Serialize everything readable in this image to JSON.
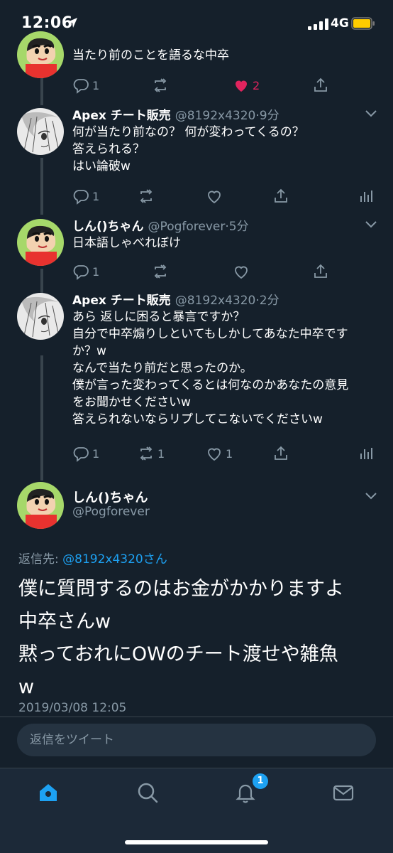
{
  "status_bar": {
    "time": "12:06",
    "network": "4G"
  },
  "tweets": [
    {
      "body": "当たり前のことを語るな中卒",
      "reply_count": "1",
      "like_count": "2"
    },
    {
      "name": "Apex チート販売",
      "handle": "@8192x4320",
      "time": "9分",
      "lines": [
        "何が当たり前なの？ 何が変わってくるの？",
        "答えられる？",
        "はい論破w"
      ],
      "reply_count": "1"
    },
    {
      "name": "しん()ちゃん",
      "handle": "@Pogforever",
      "time": "5分",
      "lines": [
        "日本語しゃべれぼけ"
      ],
      "reply_count": "1"
    },
    {
      "name": "Apex チート販売",
      "handle": "@8192x4320",
      "time": "2分",
      "lines": [
        "あら 返しに困ると暴言ですか？",
        "自分で中卒煽りしといてもしかしてあなた中卒です",
        "か？w",
        "なんで当たり前だと思ったのか。",
        "僕が言った変わってくるとは何なのかあなたの意見",
        "をお聞かせくださいw",
        "答えられないならリプしてこないでくださいw"
      ],
      "reply_count": "1",
      "retweet_count": "1",
      "like_count": "1"
    }
  ],
  "main_tweet": {
    "name": "しん()ちゃん",
    "handle": "@Pogforever",
    "reply_prefix": "返信先:",
    "reply_target": "@8192x4320さん",
    "lines": [
      "僕に質問するのはお金がかかりますよ",
      "中卒さんw",
      "黙っておれにOWのチート渡せや雑魚",
      "w"
    ],
    "timestamp": "2019/03/08 12:05"
  },
  "compose": {
    "placeholder": "返信をツイート"
  },
  "tabbar": {
    "notification_badge": "1"
  },
  "colors": {
    "background": "#15202b",
    "accent": "#1da1f2",
    "like": "#e0245e",
    "muted": "#8899a6"
  }
}
